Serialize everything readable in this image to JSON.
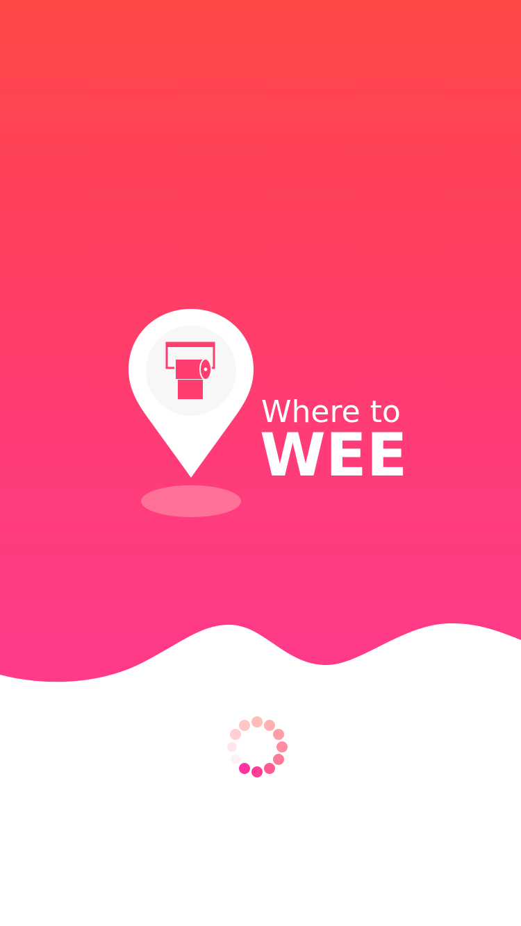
{
  "splash": {
    "app_name_line1": "Where to",
    "app_name_line2": "WEE",
    "logo_icon": "toilet-paper-pin-icon",
    "loading_indicator": "spinner"
  },
  "colors": {
    "gradient_top": "#ff4747",
    "gradient_bottom": "#ff3a8c",
    "accent": "#ff3d6e",
    "background": "#ffffff"
  }
}
